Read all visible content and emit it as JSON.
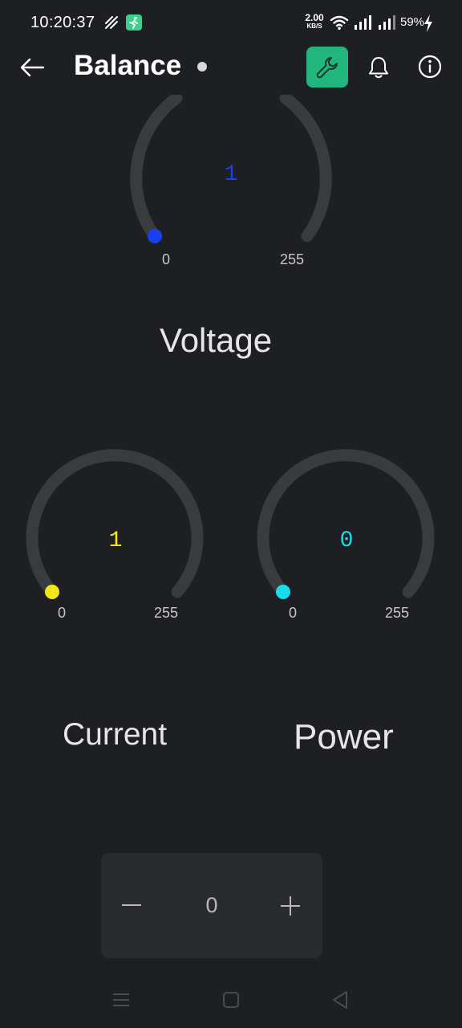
{
  "status_bar": {
    "time": "10:20:37",
    "net_speed_value": "2.00",
    "net_speed_unit": "KB/S",
    "battery": "59%"
  },
  "app_bar": {
    "title": "Balance",
    "icons": [
      "back-arrow-icon",
      "wrench-icon",
      "bell-icon",
      "info-icon"
    ],
    "accent_color": "#22b67f"
  },
  "gauges": {
    "voltage": {
      "value": "1",
      "min": "0",
      "max": "255",
      "label": "Voltage",
      "color": "#1a3ff0",
      "level": 0.004
    },
    "current": {
      "value": "1",
      "min": "0",
      "max": "255",
      "label": "Current",
      "color": "#f2e51c",
      "level": 0.004
    },
    "power": {
      "value": "0",
      "min": "0",
      "max": "255",
      "label": "Power",
      "color": "#16dcef",
      "level": 0.0
    }
  },
  "stepper": {
    "value": "0",
    "minus_icon": "minus-icon",
    "plus_icon": "plus-icon"
  },
  "nav_bar": {
    "icons": [
      "menu-icon",
      "home-icon",
      "back-icon"
    ]
  }
}
